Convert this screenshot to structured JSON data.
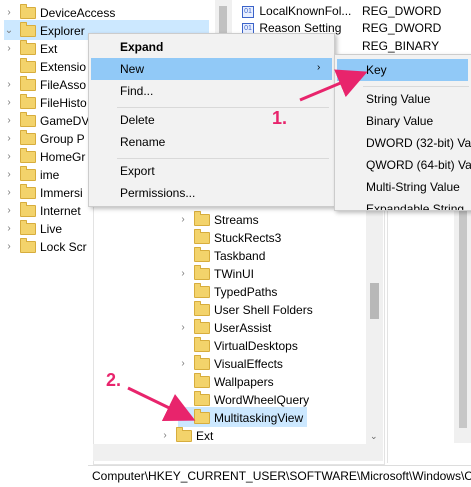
{
  "left_tree": {
    "items": [
      {
        "label": "DeviceAccess",
        "chev": "›"
      },
      {
        "label": "Explorer",
        "chev": "⌄"
      },
      {
        "label": "Ext",
        "chev": "›"
      },
      {
        "label": "Extensio",
        "chev": ""
      },
      {
        "label": "FileAsso",
        "chev": "›"
      },
      {
        "label": "FileHisto",
        "chev": "›"
      },
      {
        "label": "GameDV",
        "chev": "›"
      },
      {
        "label": "Group P",
        "chev": "›"
      },
      {
        "label": "HomeGr",
        "chev": "›"
      },
      {
        "label": "ime",
        "chev": "›"
      },
      {
        "label": "Immersi",
        "chev": "›"
      },
      {
        "label": "Internet",
        "chev": "›"
      },
      {
        "label": "Live",
        "chev": "›"
      },
      {
        "label": "Lock Scr",
        "chev": "›"
      }
    ]
  },
  "values_list": {
    "rows": [
      {
        "name": "LocalKnownFol...",
        "type": "REG_DWORD"
      },
      {
        "name": "Reason Setting",
        "type": "REG_DWORD"
      },
      {
        "name": "",
        "type": "REG_BINARY"
      }
    ]
  },
  "context_menu": {
    "items": [
      "Expand",
      "New",
      "Find...",
      "Delete",
      "Rename",
      "Export",
      "Permissions..."
    ]
  },
  "submenu": {
    "items": [
      "Key",
      "String Value",
      "Binary Value",
      "DWORD (32-bit) Va",
      "QWORD (64-bit) Va",
      "Multi-String Value",
      "Expandable String"
    ]
  },
  "lower_tree": {
    "items": [
      {
        "label": "Streams",
        "chev": "›"
      },
      {
        "label": "StuckRects3",
        "chev": ""
      },
      {
        "label": "Taskband",
        "chev": ""
      },
      {
        "label": "TWinUI",
        "chev": "›"
      },
      {
        "label": "TypedPaths",
        "chev": ""
      },
      {
        "label": "User Shell Folders",
        "chev": ""
      },
      {
        "label": "UserAssist",
        "chev": "›"
      },
      {
        "label": "VirtualDesktops",
        "chev": ""
      },
      {
        "label": "VisualEffects",
        "chev": "›"
      },
      {
        "label": "Wallpapers",
        "chev": ""
      },
      {
        "label": "WordWheelQuery",
        "chev": ""
      },
      {
        "label": "MultitaskingView",
        "chev": ""
      },
      {
        "label": "Ext",
        "chev": "›"
      }
    ]
  },
  "status_bar": {
    "path": "Computer\\HKEY_CURRENT_USER\\SOFTWARE\\Microsoft\\Windows\\Cu"
  },
  "annotations": {
    "step1": "1.",
    "step2": "2."
  },
  "colors": {
    "highlight": "#cce8ff",
    "accent": "#e8246c",
    "folder": "#f3d36b"
  }
}
